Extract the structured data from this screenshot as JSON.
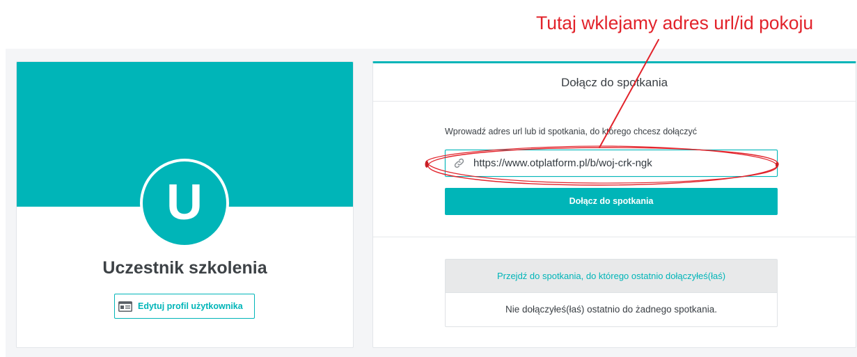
{
  "annotation": {
    "text": "Tutaj wklejamy adres url/id pokoju"
  },
  "profile": {
    "avatar_letter": "U",
    "name": "Uczestnik szkolenia",
    "edit_button_label": "Edytuj profil użytkownika",
    "edit_button_icon": "id-card-icon"
  },
  "join": {
    "title": "Dołącz do spotkania",
    "instruction": "Wprowadź adres url lub id spotkania, do którego chcesz dołączyć",
    "input_icon": "link-icon",
    "input_value": "https://www.otplatform.pl/b/woj-crk-ngk",
    "button_label": "Dołącz do spotkania"
  },
  "recent": {
    "header": "Przejdź do spotkania, do którego ostatnio dołączyłeś(łaś)",
    "empty_text": "Nie dołączyłeś(łaś) ostatnio do żadnego spotkania."
  },
  "colors": {
    "accent": "#00b5b8",
    "annotation": "#e2232b"
  }
}
